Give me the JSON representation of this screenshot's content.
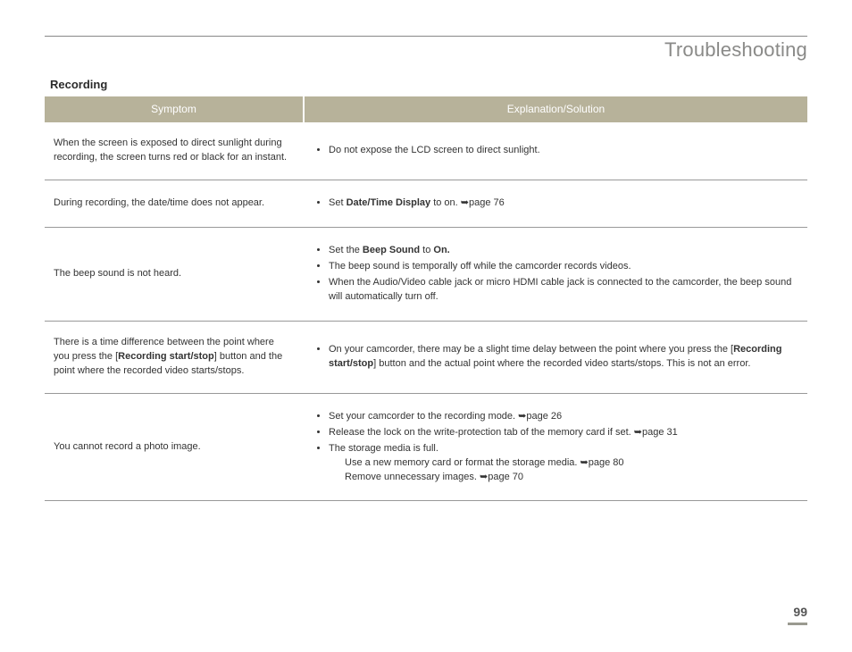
{
  "pageTitle": "Troubleshooting",
  "sectionHeading": "Recording",
  "headers": {
    "symptom": "Symptom",
    "solution": "Explanation/Solution"
  },
  "rows": {
    "r0": {
      "symptom": "When the screen is exposed to direct sunlight during recording, the screen turns red or black for an instant.",
      "b0": "Do not expose the LCD screen to direct sunlight."
    },
    "r1": {
      "symptom": "During recording, the date/time does not appear.",
      "b0_pre": "Set ",
      "b0_bold": "Date/Time Display",
      "b0_post": " to on. ",
      "b0_ref": "page 76"
    },
    "r2": {
      "symptom": "The beep sound is not heard.",
      "b0_pre": "Set the ",
      "b0_bold1": "Beep Sound",
      "b0_mid": " to ",
      "b0_bold2": "On.",
      "b1": "The beep sound is temporally off while the camcorder records videos.",
      "b2": "When the Audio/Video cable jack or micro HDMI cable jack is connected to the camcorder, the beep sound will automatically turn off."
    },
    "r3": {
      "symptom_pre": "There is a time difference between the point where you press the [",
      "symptom_bold": "Recording start/stop",
      "symptom_post": "] button and the point where the recorded video starts/stops.",
      "b0_pre": "On your camcorder, there may be a slight time delay between the point where you press the [",
      "b0_bold": "Recording start/stop",
      "b0_post": "] button and the actual point where the recorded video starts/stops. This is not an error."
    },
    "r4": {
      "symptom": "You cannot record a photo image.",
      "b0_pre": "Set your camcorder to the recording mode. ",
      "b0_ref": "page 26",
      "b1_pre": "Release the lock on the write-protection tab of the memory card if set. ",
      "b1_ref": "page 31",
      "b2": "The storage media is full.",
      "b2_sub1_pre": "Use a new memory card or format the storage media. ",
      "b2_sub1_ref": "page 80",
      "b2_sub2_pre": "Remove unnecessary images. ",
      "b2_sub2_ref": "page 70"
    }
  },
  "pageNumber": "99",
  "arrow": "➥"
}
